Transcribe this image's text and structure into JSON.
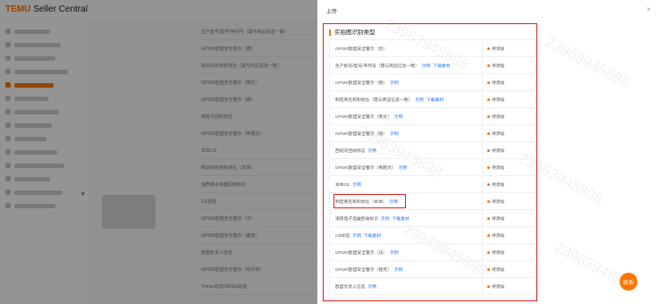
{
  "app": {
    "brand": "TEMU",
    "brand_suffix": "Seller Central"
  },
  "drawer": {
    "title": "上传",
    "close_icon": "×"
  },
  "section": {
    "title": "实拍图识别类型"
  },
  "status_label": "待添加",
  "rows": [
    {
      "name": "GPSR/欧盟安全警示（合）",
      "links": []
    },
    {
      "name": "生产批号/型号/序列号（需与商品信息一致）",
      "links": [
        "示例",
        "下载素材"
      ]
    },
    {
      "name": "GPSR/欧盟安全警示（德）",
      "links": [
        "示例"
      ]
    },
    {
      "name": "制造商名称和地址（需与商品信息一致）",
      "links": [
        "示例",
        "下载素材"
      ]
    },
    {
      "name": "GPSR/欧盟安全警示（英文）",
      "links": [
        "示例"
      ]
    },
    {
      "name": "GPSR/欧盟安全警示（德）",
      "links": [
        "示例"
      ]
    },
    {
      "name": "西班牙回收标志",
      "links": [
        "示例"
      ]
    },
    {
      "name": "GPSR/欧盟安全警示（希腊文）",
      "links": [
        "示例"
      ]
    },
    {
      "name": "本体CE",
      "links": [
        "示例"
      ]
    },
    {
      "name": "制造商名称和地址（本体）",
      "links": [
        "示例"
      ]
    },
    {
      "name": "滚筒电子电器回收标识",
      "links": [
        "示例",
        "下载素材"
      ]
    },
    {
      "name": "CE标签",
      "links": [
        "示例",
        "下载素材"
      ]
    },
    {
      "name": "GPSR/欧盟安全警示（法）",
      "links": [
        "示例"
      ]
    },
    {
      "name": "GPSR/欧盟安全警示（捷克）",
      "links": [
        "示例"
      ]
    },
    {
      "name": "欧盟负责人信息",
      "links": [
        "示例"
      ]
    }
  ],
  "highlighted_row_index": 9,
  "background_rows": [
    "生产批号/型号/序列号（需与商品信息一致）",
    "GPSR/欧盟安全警示（德）",
    "制造商名称和地址（需与商品信息一致）",
    "GPSR/欧盟安全警示（英文）",
    "GPSR/欧盟安全警示（德）",
    "西班牙回收标志",
    "GPSR/欧盟安全警示（希腊文）",
    "本体CE",
    "制造商名称和地址（本体）",
    "滚筒电子电器回收标识",
    "CE标签",
    "GPSR/欧盟安全警示（法）",
    "GPSR/欧盟安全警示（捷克）",
    "欧盟负责人信息",
    "GPSR/欧盟安全警示（匈牙利）",
    "Trimen标志/WEEE标签"
  ],
  "watermark": "23963945898",
  "fab_label": "联系",
  "colors": {
    "brand": "#fb7701",
    "link": "#1e6fff",
    "highlight": "#e02020"
  },
  "icons": {
    "close": "close-icon",
    "fab": "support-icon",
    "chevron": "chevron-down-icon"
  }
}
